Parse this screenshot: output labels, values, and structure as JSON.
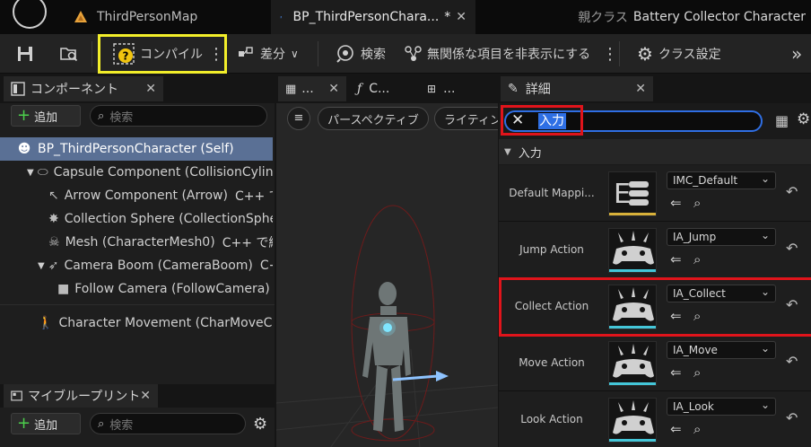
{
  "window": {
    "tabs": [
      {
        "label": "ThirdPersonMap"
      },
      {
        "label": "BP_ThirdPersonChara...",
        "modified": "*"
      }
    ],
    "parent_class_label": "親クラス",
    "parent_class_value": "Battery Collector Character"
  },
  "toolbar": {
    "compile_label": "コンパイル",
    "diff_label": "差分",
    "search_label": "検索",
    "hide_label": "無関係な項目を非表示にする",
    "class_settings_label": "クラス設定"
  },
  "components": {
    "tab_label": "コンポーネント",
    "add_label": "追加",
    "search_placeholder": "検索",
    "items": [
      {
        "label": "BP_ThirdPersonCharacter (Self)",
        "icon": "person-icon"
      },
      {
        "label": "Capsule Component (CollisionCylind",
        "icon": "capsule-icon"
      },
      {
        "label": "Arrow Component (Arrow)",
        "suffix": "C++ で編",
        "icon": "arrow-icon"
      },
      {
        "label": "Collection Sphere (CollectionSphere",
        "icon": "sphere-icon"
      },
      {
        "label": "Mesh (CharacterMesh0)",
        "suffix": "C++ で編集",
        "icon": "skeleton-icon"
      },
      {
        "label": "Camera Boom (CameraBoom)",
        "suffix": "C++",
        "icon": "boom-icon"
      },
      {
        "label": "Follow Camera (FollowCamera)",
        "suffix": "C",
        "icon": "camera-icon"
      },
      {
        "label": "Character Movement (CharMoveCom",
        "icon": "movement-icon"
      }
    ]
  },
  "blueprints": {
    "tab_label": "マイブループリント",
    "add_label": "追加",
    "search_placeholder": "検索"
  },
  "viewport": {
    "tabs": [
      "...",
      "C...",
      "..."
    ],
    "perspective_label": "パースペクティブ",
    "lighting_label": "ライティン"
  },
  "details": {
    "tab_label": "詳細",
    "search_value": "入力",
    "section_label": "入力",
    "rows": [
      {
        "label": "Default Mappi...",
        "value": "IMC_Default",
        "bar_color": "#d8b13a"
      },
      {
        "label": "Jump Action",
        "value": "IA_Jump",
        "bar_color": "#44c6d8"
      },
      {
        "label": "Collect Action",
        "value": "IA_Collect",
        "bar_color": "#44c6d8"
      },
      {
        "label": "Move Action",
        "value": "IA_Move",
        "bar_color": "#44c6d8"
      },
      {
        "label": "Look Action",
        "value": "IA_Look",
        "bar_color": "#44c6d8"
      }
    ]
  },
  "colors": {
    "highlight_yellow": "#f2ee2a",
    "highlight_red": "#e0141b",
    "search_focus_blue": "#2f6ee3"
  }
}
